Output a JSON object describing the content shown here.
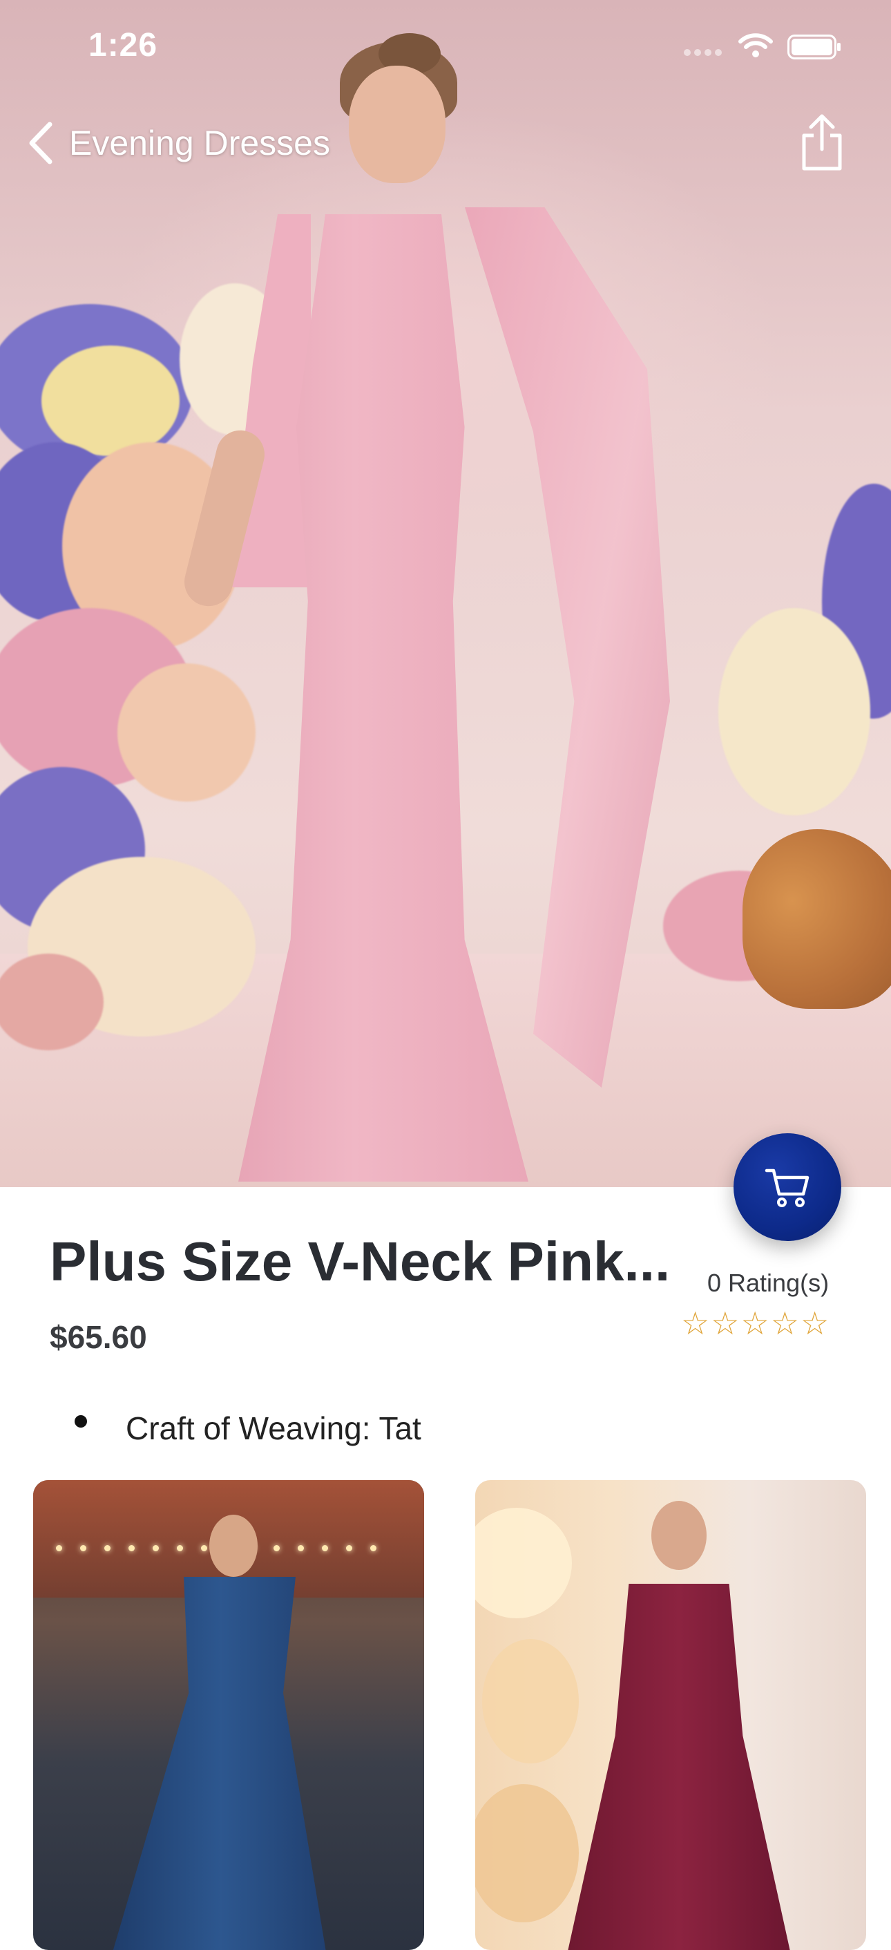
{
  "status_bar": {
    "time": "1:26"
  },
  "nav": {
    "back_label": "Evening Dresses"
  },
  "product": {
    "title": "Plus Size V-Neck Pink...",
    "price": "$65.60",
    "rating_text": "0 Rating(s)",
    "stars": "☆☆☆☆☆",
    "rating_value": 0,
    "features": [
      "Craft of Weaving: Tat"
    ]
  },
  "colors": {
    "accent": "#0d2a8a",
    "star": "#e0a53a",
    "text_dark": "#2a2d33"
  },
  "icons": {
    "back": "chevron-left-icon",
    "share": "share-icon",
    "cart": "cart-icon"
  },
  "related": [
    {
      "image": "navy-sequin-gown"
    },
    {
      "image": "burgundy-ruffle-dress"
    }
  ]
}
